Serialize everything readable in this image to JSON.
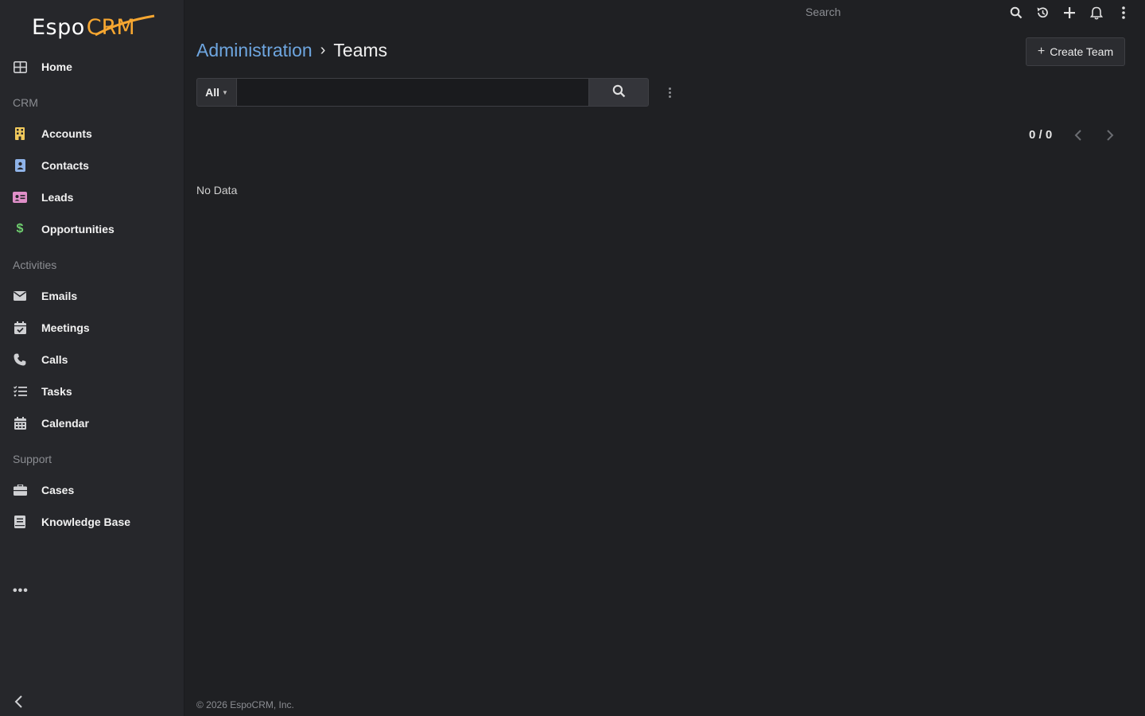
{
  "app": {
    "logo_main": "Espo",
    "logo_accent": "CRM",
    "brand_color": "#f7a731"
  },
  "sidebar": {
    "home": {
      "label": "Home",
      "icon": "home-grid-icon"
    },
    "groups": {
      "crm": "CRM",
      "activities": "Activities",
      "support": "Support"
    },
    "items": {
      "accounts": {
        "label": "Accounts",
        "icon": "building-icon",
        "color": "#f0c95c"
      },
      "contacts": {
        "label": "Contacts",
        "icon": "contact-card-icon",
        "color": "#8fb3e8"
      },
      "leads": {
        "label": "Leads",
        "icon": "id-card-icon",
        "color": "#e08fc9"
      },
      "opportunities": {
        "label": "Opportunities",
        "icon": "dollar-icon",
        "color": "#6fcf6f"
      },
      "emails": {
        "label": "Emails",
        "icon": "envelope-icon"
      },
      "meetings": {
        "label": "Meetings",
        "icon": "calendar-check-icon"
      },
      "calls": {
        "label": "Calls",
        "icon": "phone-icon"
      },
      "tasks": {
        "label": "Tasks",
        "icon": "tasks-list-icon"
      },
      "calendar": {
        "label": "Calendar",
        "icon": "calendar-grid-icon"
      },
      "cases": {
        "label": "Cases",
        "icon": "briefcase-icon"
      },
      "knowledge_base": {
        "label": "Knowledge Base",
        "icon": "book-icon"
      }
    },
    "more": "•••"
  },
  "topbar": {
    "search_placeholder": "Search"
  },
  "header": {
    "breadcrumb_parent": "Administration",
    "breadcrumb_separator": "›",
    "title": "Teams",
    "create_button": "Create Team"
  },
  "searchbar": {
    "filter_label": "All",
    "input_value": ""
  },
  "pagination": {
    "text": "0 / 0"
  },
  "list": {
    "empty_text": "No Data"
  },
  "footer": {
    "text": "© 2026 EspoCRM, Inc."
  }
}
